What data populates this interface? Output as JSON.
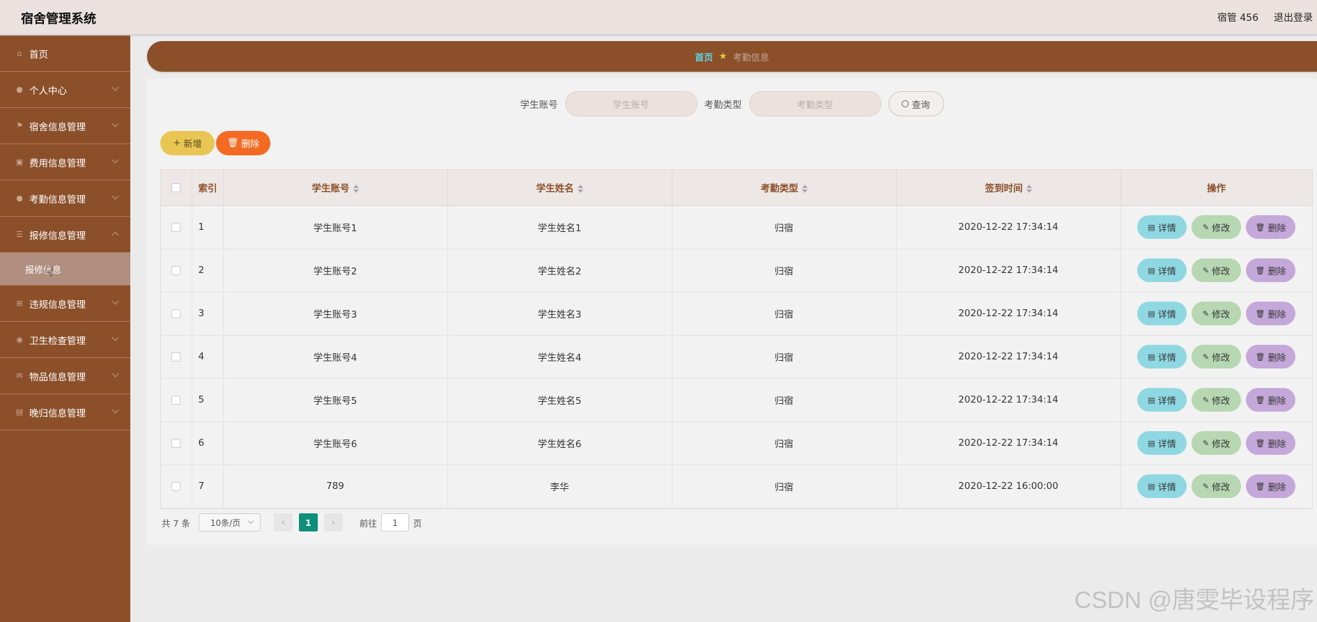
{
  "header": {
    "title": "宿舍管理系统",
    "user": "宿管 456",
    "logout": "退出登录"
  },
  "sidebar": {
    "items": [
      {
        "label": "首页",
        "icon": "home-icon"
      },
      {
        "label": "个人中心",
        "icon": "user-icon"
      },
      {
        "label": "宿舍信息管理",
        "icon": "flag-icon"
      },
      {
        "label": "费用信息管理",
        "icon": "clipboard-icon"
      },
      {
        "label": "考勤信息管理",
        "icon": "mic-icon"
      },
      {
        "label": "报修信息管理",
        "icon": "menu-icon"
      },
      {
        "label": "违规信息管理",
        "icon": "crop-icon"
      },
      {
        "label": "卫生检查管理",
        "icon": "bulb-icon"
      },
      {
        "label": "物品信息管理",
        "icon": "mail-icon"
      },
      {
        "label": "晚归信息管理",
        "icon": "monitor-icon"
      }
    ],
    "submenu": {
      "label": "报修信息"
    }
  },
  "breadcrumb": {
    "home": "首页",
    "current": "考勤信息"
  },
  "search": {
    "account_label": "学生账号",
    "account_placeholder": "学生账号",
    "type_label": "考勤类型",
    "type_placeholder": "考勤类型",
    "query_label": "查询"
  },
  "toolbar": {
    "add_label": "新增",
    "delete_label": "删除"
  },
  "table": {
    "columns": [
      "索引",
      "学生账号",
      "学生姓名",
      "考勤类型",
      "签到时间",
      "操作"
    ],
    "rows": [
      {
        "index": "1",
        "account": "学生账号1",
        "name": "学生姓名1",
        "type": "归宿",
        "time": "2020-12-22 17:34:14"
      },
      {
        "index": "2",
        "account": "学生账号2",
        "name": "学生姓名2",
        "type": "归宿",
        "time": "2020-12-22 17:34:14"
      },
      {
        "index": "3",
        "account": "学生账号3",
        "name": "学生姓名3",
        "type": "归宿",
        "time": "2020-12-22 17:34:14"
      },
      {
        "index": "4",
        "account": "学生账号4",
        "name": "学生姓名4",
        "type": "归宿",
        "time": "2020-12-22 17:34:14"
      },
      {
        "index": "5",
        "account": "学生账号5",
        "name": "学生姓名5",
        "type": "归宿",
        "time": "2020-12-22 17:34:14"
      },
      {
        "index": "6",
        "account": "学生账号6",
        "name": "学生姓名6",
        "type": "归宿",
        "time": "2020-12-22 17:34:14"
      },
      {
        "index": "7",
        "account": "789",
        "name": "李华",
        "type": "归宿",
        "time": "2020-12-22 16:00:00"
      }
    ],
    "actions": {
      "detail": "详情",
      "edit": "修改",
      "delete": "删除"
    }
  },
  "pagination": {
    "total": "共 7 条",
    "page_size": "10条/页",
    "current_page": "1",
    "goto_label": "前往",
    "goto_value": "1",
    "page_suffix": "页"
  },
  "watermark": "CSDN @唐雯毕设程序"
}
